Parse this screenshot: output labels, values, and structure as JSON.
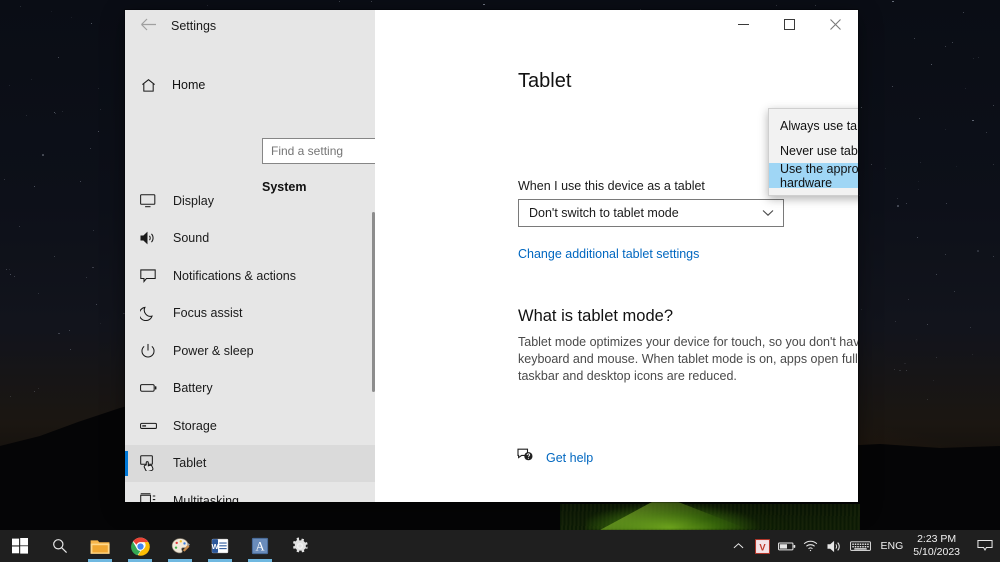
{
  "window": {
    "title": "Settings",
    "back_icon": "back-arrow-icon",
    "minimize_icon": "minimize-icon",
    "maximize_icon": "maximize-icon",
    "close_icon": "close-icon"
  },
  "sidebar": {
    "home_label": "Home",
    "home_icon": "home-icon",
    "search": {
      "value": "",
      "placeholder": "Find a setting",
      "icon": "search-icon"
    },
    "group_title": "System",
    "items": [
      {
        "label": "Display",
        "icon": "monitor-icon",
        "selected": false
      },
      {
        "label": "Sound",
        "icon": "speaker-icon",
        "selected": false
      },
      {
        "label": "Notifications & actions",
        "icon": "chat-bubble-icon",
        "selected": false
      },
      {
        "label": "Focus assist",
        "icon": "moon-icon",
        "selected": false
      },
      {
        "label": "Power & sleep",
        "icon": "power-icon",
        "selected": false
      },
      {
        "label": "Battery",
        "icon": "battery-icon",
        "selected": false
      },
      {
        "label": "Storage",
        "icon": "storage-icon",
        "selected": false
      },
      {
        "label": "Tablet",
        "icon": "tablet-hand-icon",
        "selected": true
      },
      {
        "label": "Multitasking",
        "icon": "multitasking-icon",
        "selected": false
      }
    ]
  },
  "main": {
    "page_title": "Tablet",
    "when_label": "When I use this device as a tablet",
    "when_value": "Don't switch to tablet mode",
    "when_chevron_icon": "chevron-down-icon",
    "additional_link": "Change additional tablet settings",
    "section_heading": "What is tablet mode?",
    "section_body": "Tablet mode optimizes your device for touch, so you don't have to use a keyboard and mouse. When tablet mode is on, apps open full-screen and taskbar and desktop icons are reduced.",
    "get_help_label": "Get help",
    "get_help_icon": "help-chat-icon"
  },
  "dropdown": {
    "open": true,
    "options": [
      {
        "label": "Always use tablet mode",
        "highlighted": false
      },
      {
        "label": "Never use tablet mode",
        "highlighted": false
      },
      {
        "label": "Use the appropriate mode for my hardware",
        "highlighted": true
      }
    ]
  },
  "taskbar": {
    "buttons": [
      {
        "name": "start-button",
        "icon": "windows-logo-icon",
        "active": false
      },
      {
        "name": "search-button",
        "icon": "search-icon",
        "active": false
      },
      {
        "name": "file-explorer-button",
        "icon": "folder-icon",
        "active": true
      },
      {
        "name": "chrome-button",
        "icon": "chrome-icon",
        "active": true
      },
      {
        "name": "paint-button",
        "icon": "paint-palette-icon",
        "active": true
      },
      {
        "name": "word-button",
        "icon": "word-icon",
        "active": true
      },
      {
        "name": "app-a-button",
        "icon": "letter-a-app-icon",
        "active": true
      },
      {
        "name": "settings-button",
        "icon": "gear-icon",
        "active": false
      }
    ],
    "tray": [
      {
        "name": "show-hidden-icons",
        "icon": "chevron-up-icon"
      },
      {
        "name": "vpn-tray-icon",
        "icon": "letter-v-icon"
      },
      {
        "name": "battery-tray-icon",
        "icon": "battery-icon"
      },
      {
        "name": "network-tray-icon",
        "icon": "wifi-icon"
      },
      {
        "name": "volume-tray-icon",
        "icon": "speaker-icon"
      },
      {
        "name": "keyboard-tray-icon",
        "icon": "keyboard-icon"
      }
    ],
    "language": "ENG",
    "clock_time": "2:23 PM",
    "clock_date": "5/10/2023",
    "notifications_icon": "notification-icon"
  },
  "colors": {
    "accent": "#0078d7",
    "link": "#0067c0",
    "highlight": "#9fd6f5",
    "sidebar_bg": "#e6e6e6",
    "taskbar_bg": "#1f1f1f"
  }
}
